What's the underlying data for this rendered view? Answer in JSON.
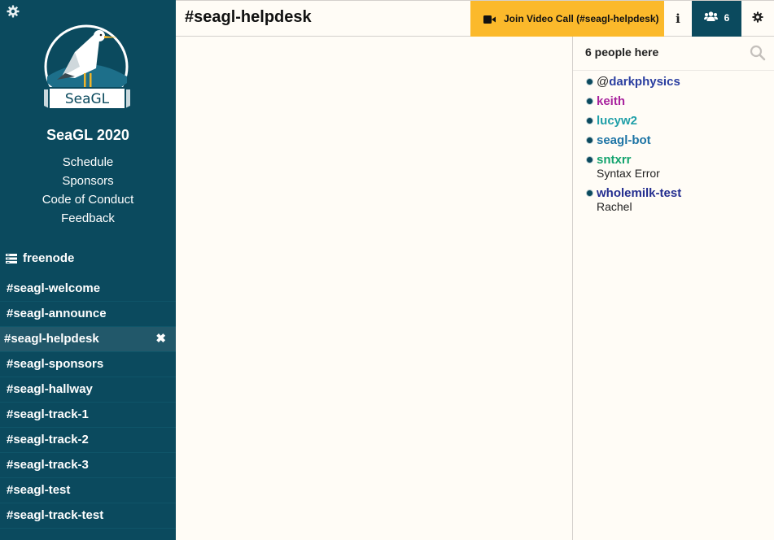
{
  "sidebar": {
    "settings_icon": "gear-icon",
    "conference": {
      "logo_text": "SeaGL",
      "title": "SeaGL 2020",
      "links": [
        "Schedule",
        "Sponsors",
        "Code of Conduct",
        "Feedback"
      ]
    },
    "network": {
      "icon": "server-icon",
      "name": "freenode"
    },
    "channels": [
      {
        "name": "#seagl-welcome",
        "active": false
      },
      {
        "name": "#seagl-announce",
        "active": false
      },
      {
        "name": "#seagl-helpdesk",
        "active": true,
        "close_label": "✖"
      },
      {
        "name": "#seagl-sponsors",
        "active": false
      },
      {
        "name": "#seagl-hallway",
        "active": false
      },
      {
        "name": "#seagl-track-1",
        "active": false
      },
      {
        "name": "#seagl-track-2",
        "active": false
      },
      {
        "name": "#seagl-track-3",
        "active": false
      },
      {
        "name": "#seagl-test",
        "active": false
      },
      {
        "name": "#seagl-track-test",
        "active": false
      }
    ]
  },
  "header": {
    "channel_title": "#seagl-helpdesk",
    "video_call_label": "Join Video Call (#seagl-helpdesk)",
    "video_icon": "video-camera-icon",
    "info_label": "i",
    "people_icon": "users-icon",
    "people_count": "6",
    "settings_icon": "gear-icon"
  },
  "nicklist": {
    "title": "6 people here",
    "search_icon": "search-icon",
    "users": [
      {
        "prefix": "@",
        "nick": "darkphysics",
        "color": "#2a3ea0",
        "realname": ""
      },
      {
        "prefix": "",
        "nick": "keith",
        "color": "#a8239e",
        "realname": ""
      },
      {
        "prefix": "",
        "nick": "lucyw2",
        "color": "#1f9fa8",
        "realname": ""
      },
      {
        "prefix": "",
        "nick": "seagl-bot",
        "color": "#1d74a5",
        "realname": ""
      },
      {
        "prefix": "",
        "nick": "sntxrr",
        "color": "#13a36e",
        "realname": "Syntax Error"
      },
      {
        "prefix": "",
        "nick": "wholemilk-test",
        "color": "#232d8f",
        "realname": "Rachel"
      }
    ]
  },
  "colors": {
    "sidebar_bg": "#0b4a5e",
    "accent_yellow": "#fbb92b",
    "content_bg": "#fffcf6"
  }
}
